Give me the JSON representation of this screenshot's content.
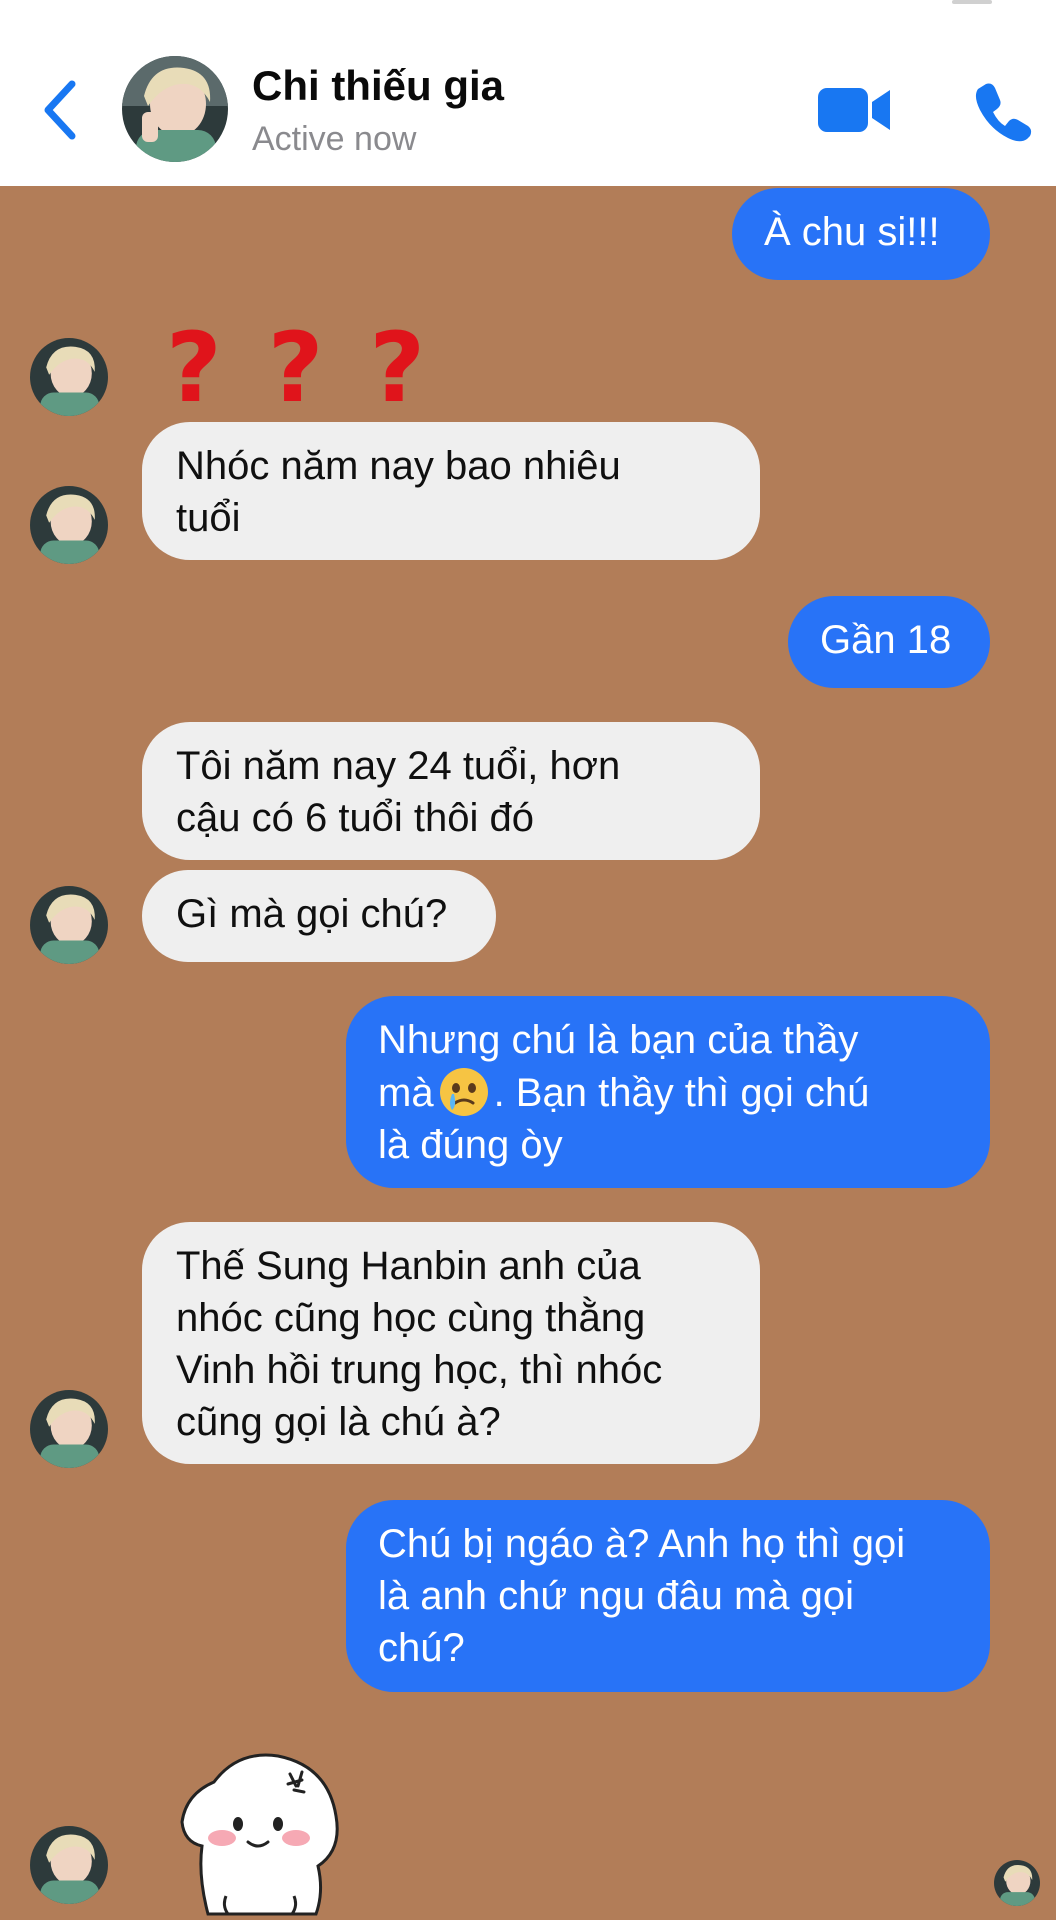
{
  "header": {
    "contact_name": "Chi thiếu gia",
    "status": "Active now",
    "back_icon": "chevron-left-icon",
    "video_icon": "video-camera-icon",
    "call_icon": "phone-icon"
  },
  "colors": {
    "accent": "#2873f7",
    "chat_background": "#b27d58",
    "incoming_bubble": "#efefef",
    "question_mark": "#e0141b"
  },
  "messages": {
    "m1": "À chu si!!!",
    "qmarks": [
      "?",
      "?",
      "?"
    ],
    "m2": "Nhóc năm nay bao nhiêu\ntuổi",
    "m3": "Gần 18",
    "m4": "Tôi năm nay 24 tuổi, hơn\ncậu có 6 tuổi thôi đó",
    "m5": "Gì mà gọi chú?",
    "m6_line1": "Nhưng chú là bạn của thầy",
    "m6_line2a": "mà",
    "m6_line2b": ". Bạn thầy thì gọi chú",
    "m6_line3": "là đúng òy",
    "m7": "Thế Sung Hanbin anh của\nnhóc cũng học cùng thằng\nVinh hồi trung học, thì nhóc\ncũng gọi là chú à?",
    "m8": "Chú bị ngáo à? Anh họ thì gọi\nlà anh chứ ngu đâu mà gọi\nchú?"
  }
}
